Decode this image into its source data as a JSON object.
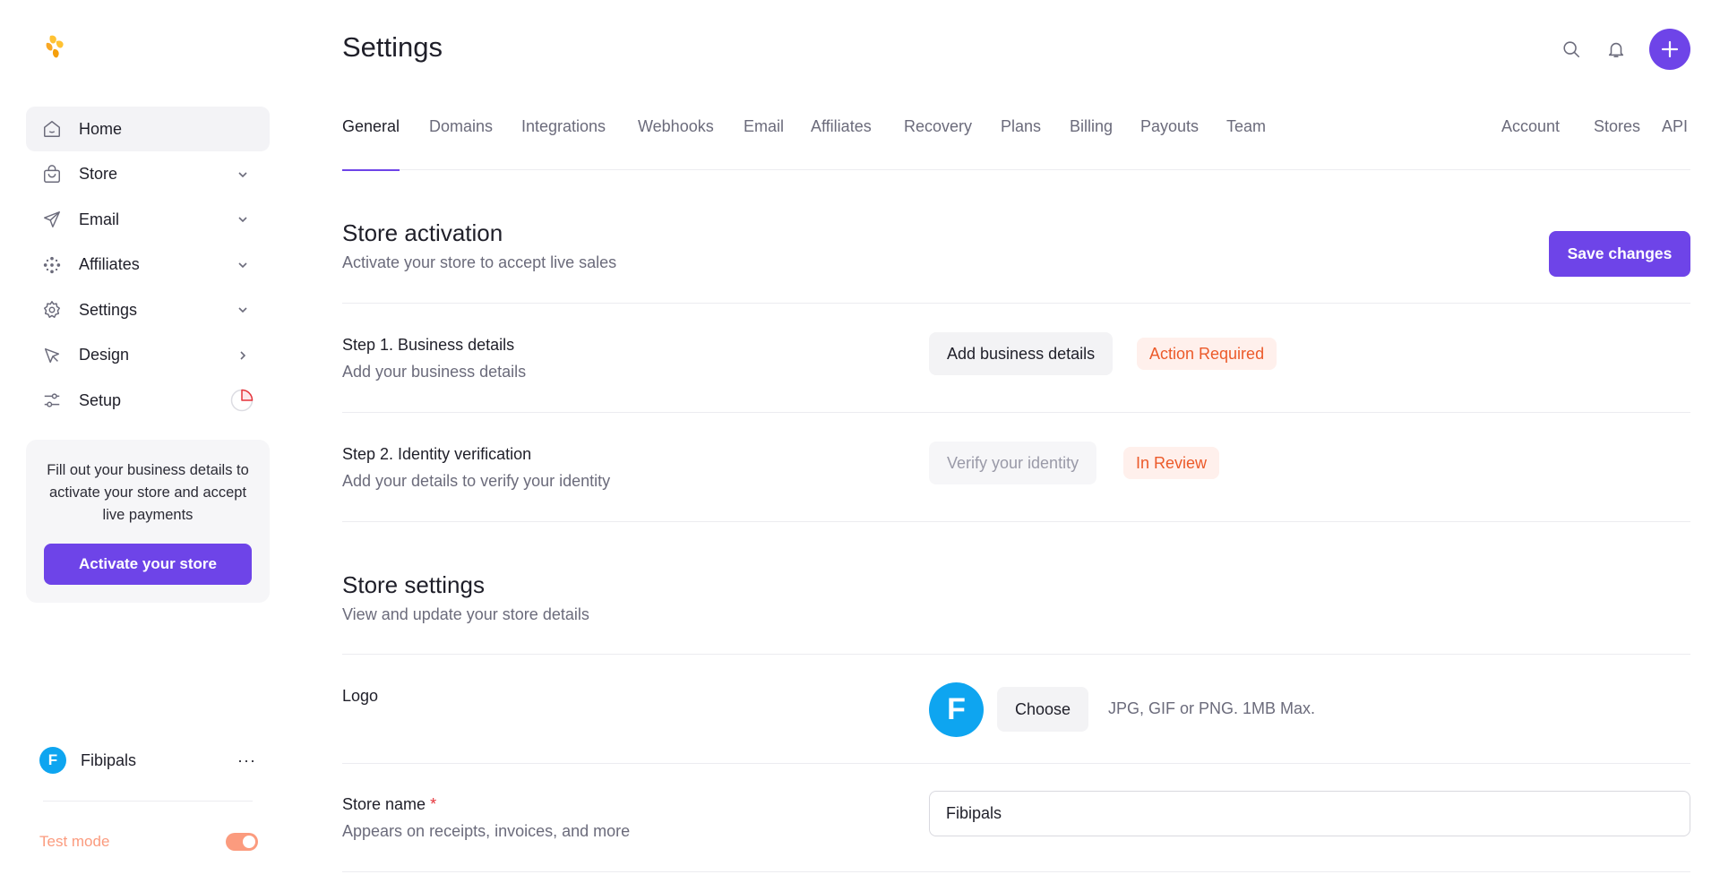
{
  "sidebar": {
    "nav": [
      {
        "label": "Home",
        "icon": "home-icon",
        "trail": "none",
        "active": true
      },
      {
        "label": "Store",
        "icon": "shopping-bag-icon",
        "trail": "chevron-down"
      },
      {
        "label": "Email",
        "icon": "send-icon",
        "trail": "chevron-down"
      },
      {
        "label": "Affiliates",
        "icon": "affiliates-dots-icon",
        "trail": "chevron-down"
      },
      {
        "label": "Settings",
        "icon": "gear-icon",
        "trail": "chevron-down"
      },
      {
        "label": "Design",
        "icon": "cursor-arrow-icon",
        "trail": "chevron-right"
      },
      {
        "label": "Setup",
        "icon": "sliders-icon",
        "trail": "progress-pie"
      }
    ],
    "promo": {
      "text": "Fill out your business details to activate your store and accept live payments",
      "button": "Activate your store"
    },
    "store": {
      "initial": "F",
      "name": "Fibipals",
      "menu": "···"
    },
    "test_mode": {
      "label": "Test mode",
      "enabled": true
    }
  },
  "header": {
    "title": "Settings"
  },
  "tabs": {
    "left": [
      "General",
      "Domains",
      "Integrations",
      "Webhooks",
      "Email",
      "Affiliates",
      "Recovery",
      "Plans",
      "Billing",
      "Payouts",
      "Team"
    ],
    "right": [
      "Account",
      "Stores",
      "API"
    ],
    "active": "General"
  },
  "activation": {
    "title": "Store activation",
    "subtitle": "Activate your store to accept live sales",
    "save_label": "Save changes",
    "step1": {
      "title": "Step 1. Business details",
      "subtitle": "Add your business details",
      "button": "Add business details",
      "badge": "Action Required"
    },
    "step2": {
      "title": "Step 2. Identity verification",
      "subtitle": "Add your details to verify your identity",
      "button": "Verify your identity",
      "badge": "In Review"
    }
  },
  "store_settings": {
    "title": "Store settings",
    "subtitle": "View and update your store details",
    "logo": {
      "label": "Logo",
      "initial": "F",
      "choose_label": "Choose",
      "hint": "JPG, GIF or PNG. 1MB Max."
    },
    "store_name": {
      "label": "Store name",
      "required_mark": "*",
      "subtitle": "Appears on receipts, invoices, and more",
      "value": "Fibipals"
    }
  },
  "colors": {
    "accent": "#6e44e8",
    "badge_text": "#ec5a2a",
    "badge_bg": "#fff0ec",
    "avatar": "#0ea5f0",
    "test_mode": "#fb9b7e"
  }
}
